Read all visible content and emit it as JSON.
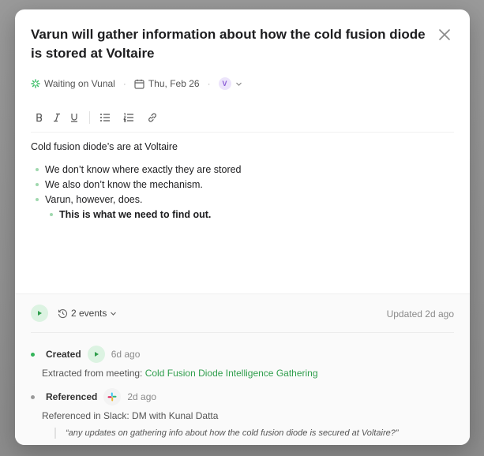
{
  "task": {
    "title": "Varun will gather information about how the cold fusion diode is stored at Voltaire"
  },
  "meta": {
    "status": "Waiting on Vunal",
    "date": "Thu, Feb 26",
    "assignee_initial": "V"
  },
  "toolbar": {
    "icons": [
      "bold-icon",
      "italic-icon",
      "underline-icon",
      "bullet-list-icon",
      "numbered-list-icon",
      "link-icon"
    ]
  },
  "content": {
    "paragraph": "Cold fusion diode’s are at Voltaire",
    "bullets": [
      "We don’t know where exactly they are stored",
      "We also don’t know the mechanism.",
      "Varun, however, does."
    ],
    "sub_bullet": "This is what we need to find out."
  },
  "footer": {
    "events_label": "2 events",
    "updated": "Updated 2d ago",
    "events": [
      {
        "title": "Created",
        "time": "6d ago",
        "line_prefix": "Extracted from meeting: ",
        "link": "Cold Fusion Diode Intelligence Gathering",
        "dot_color": "#34b55a"
      },
      {
        "title": "Referenced",
        "time": "2d ago",
        "line": "Referenced in Slack: DM with Kunal Datta",
        "quote": "“any updates on gathering info about how the cold fusion diode is secured at Voltaire?”",
        "dot_color": "#9a9a9a"
      }
    ]
  }
}
